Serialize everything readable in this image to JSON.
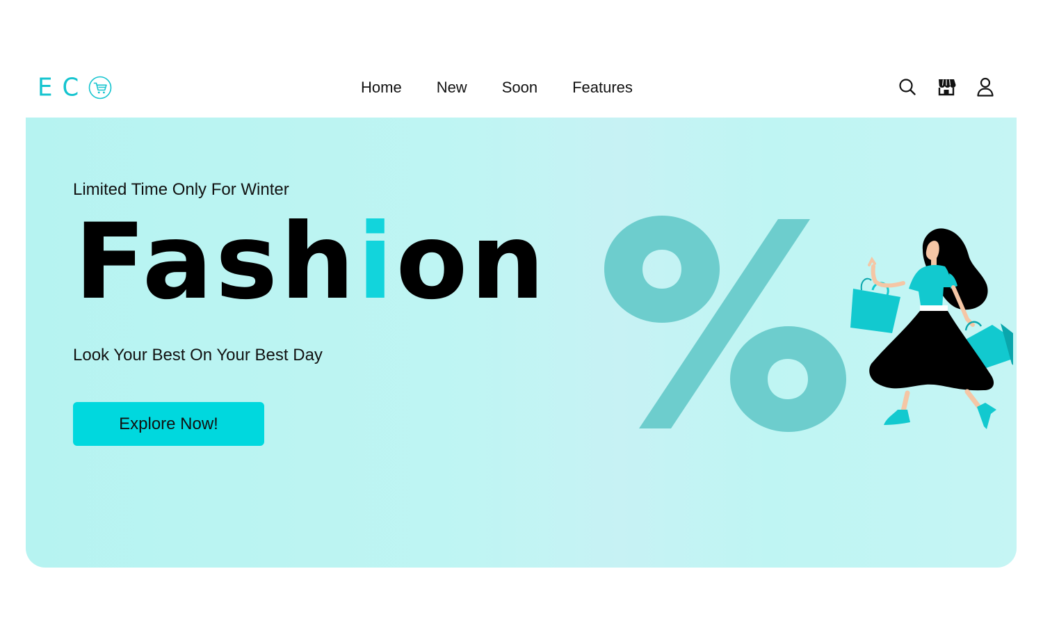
{
  "brand": {
    "letters": [
      "E",
      "C"
    ],
    "cart_icon": "shopping-cart-icon",
    "accent_color": "#14c4cf"
  },
  "nav": {
    "items": [
      {
        "label": "Home"
      },
      {
        "label": "New"
      },
      {
        "label": "Soon"
      },
      {
        "label": "Features"
      }
    ]
  },
  "header_icons": [
    "search-icon",
    "store-icon",
    "user-icon"
  ],
  "hero": {
    "eyebrow": "Limited Time Only For Winter",
    "headline_before": "Fash",
    "headline_accent": "i",
    "headline_after": "on",
    "tagline": "Look Your Best On Your Best Day",
    "cta_label": "Explore Now!",
    "background_color": "#bdf4f2",
    "cta_color": "#00d8de",
    "headline_accent_color": "#12d4dc",
    "illustration": "shopping-woman-percent-illustration"
  }
}
